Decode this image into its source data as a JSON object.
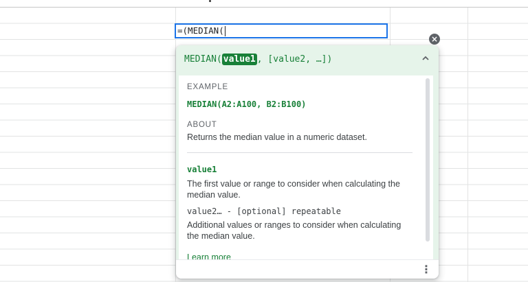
{
  "cell_editor": {
    "value": "=(MEDIAN("
  },
  "formula_help": {
    "signature_prefix": "MEDIAN(",
    "signature_active_param": "value1",
    "signature_rest": ", [value2, …])",
    "example_label": "EXAMPLE",
    "example_value": "MEDIAN(A2:A100, B2:B100)",
    "about_label": "ABOUT",
    "about_text": "Returns the median value in a numeric dataset.",
    "params": [
      {
        "name": "value1",
        "description": "The first value or range to consider when calculating the median value."
      },
      {
        "name": "value2… - [optional] repeatable",
        "description": "Additional values or ranges to consider when calculating the median value."
      }
    ],
    "learn_more_label": "Learn more"
  },
  "icons": {
    "close": "close-icon",
    "collapse": "chevron-up-icon",
    "more": "more-vert-icon"
  },
  "colors": {
    "accent_green": "#188038",
    "header_bg": "#e6f4ea",
    "selection_border": "#1a73e8",
    "gridline": "#e2e3e3"
  }
}
